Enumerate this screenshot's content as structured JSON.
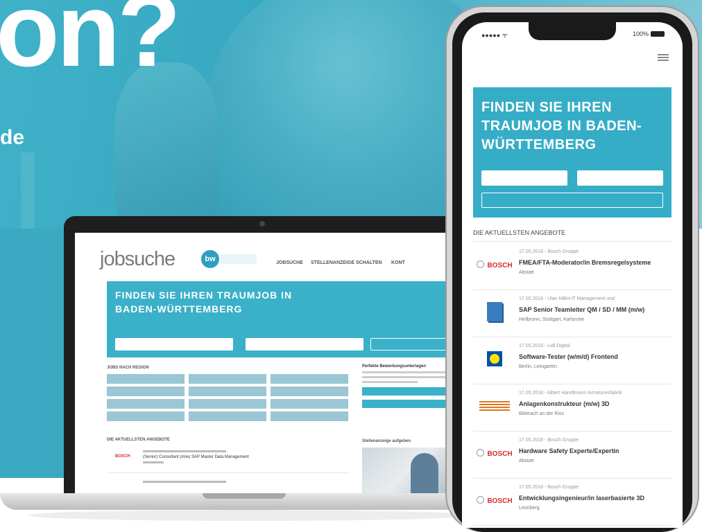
{
  "hero": {
    "title": "on?",
    "subtitle": "de"
  },
  "laptop": {
    "logo": "jobsuche",
    "logo_badge": "bw",
    "nav": [
      "JOBSUCHE",
      "STELLENANZEIGE SCHALTEN",
      "KONT"
    ],
    "hero_title": "FINDEN SIE IHREN TRAUMJOB IN BADEN-WÜRTTEMBERG",
    "region_label": "JOBS NACH REGION",
    "side_title": "Perfekte Bewerbungsunterlagen",
    "offers_label": "DIE AKTUELLSTEN ANGEBOTE",
    "offer": {
      "logo": "BOSCH",
      "title": "(Senior) Consultant (m/w) SAP Master Data Management"
    },
    "side_photo_label": "Stellenanzeige aufgeben"
  },
  "phone": {
    "status_battery": "100%",
    "hero_title": "FINDEN SIE IHREN TRAUMJOB IN BADEN-WÜRTTEMBERG",
    "section_label": "DIE AKTUELLSTEN ANGEBOTE",
    "offers": [
      {
        "logo": "BOSCH",
        "logo_type": "bosch",
        "meta": "17.05.2018 - Bosch Gruppe",
        "title": "FMEA/FTA-Moderator/in Bremsregelsysteme",
        "location": "Abstatt"
      },
      {
        "logo": "",
        "logo_type": "sap",
        "meta": "17.05.2018 - Ulan MBH-IT Management und",
        "title": "SAP Senior Teamleiter QM / SD / MM (m/w)",
        "location": "Heilbronn, Stuttgart, Karlsruhe"
      },
      {
        "logo": "",
        "logo_type": "lidl",
        "meta": "17.05.2018 - Lidl Digital",
        "title": "Software-Tester (w/m/d) Frontend",
        "location": "Berlin, Leingarten"
      },
      {
        "logo": "",
        "logo_type": "hand",
        "meta": "17.05.2018 - Albert Handtmann Armaturenfabrik",
        "title": "Anlagenkonstrukteur (m/w) 3D",
        "location": "Biberach an der Riss"
      },
      {
        "logo": "BOSCH",
        "logo_type": "bosch",
        "meta": "17.05.2018 - Bosch Gruppe",
        "title": "Hardware Safety Experte/Expertin",
        "location": "Abstatt"
      },
      {
        "logo": "BOSCH",
        "logo_type": "bosch",
        "meta": "17.05.2018 - Bosch Gruppe",
        "title": "Entwicklungsingenieur/in laserbasierte 3D",
        "location": "Leonberg"
      }
    ]
  },
  "colors": {
    "brand_teal": "#36adc7",
    "bosch_red": "#d32c2c"
  }
}
